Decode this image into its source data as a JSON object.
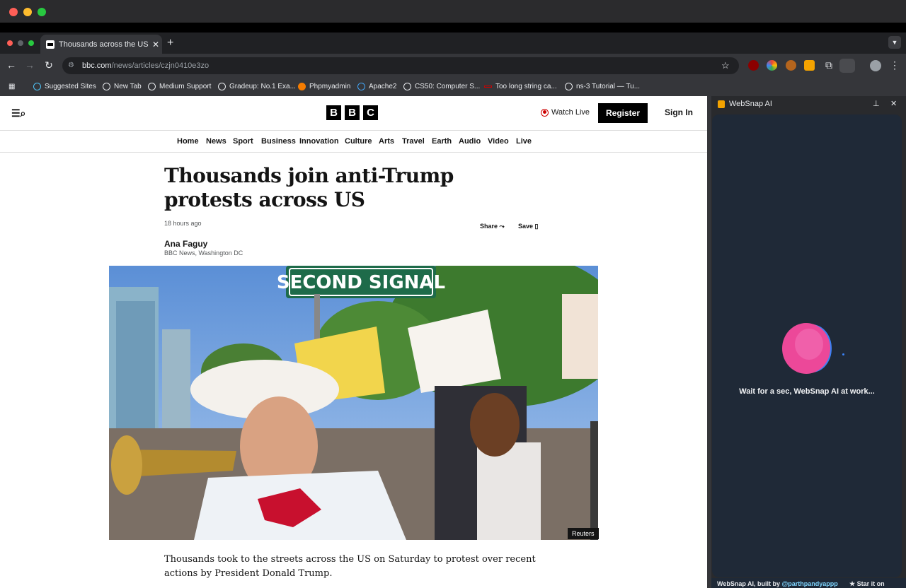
{
  "tab": {
    "title": "Thousands across the US pro",
    "close": "✕",
    "new": "+"
  },
  "omnibox": {
    "host": "bbc.com",
    "path": "/news/articles/czjn0410e3zo"
  },
  "bookmarks": [
    "Suggested Sites",
    "New Tab",
    "Medium Support",
    "Gradeup: No.1 Exa...",
    "Phpmyadmin",
    "Apache2",
    "CS50: Computer S...",
    "Too long string ca...",
    "ns-3 Tutorial — Tu..."
  ],
  "bbc": {
    "logo": [
      "B",
      "B",
      "C"
    ],
    "watch_live": "Watch Live",
    "register": "Register",
    "sign_in": "Sign In",
    "nav": [
      "Home",
      "News",
      "Sport",
      "Business",
      "Innovation",
      "Culture",
      "Arts",
      "Travel",
      "Earth",
      "Audio",
      "Video",
      "Live"
    ]
  },
  "article": {
    "headline": "Thousands join anti-Trump protests across US",
    "timestamp": "18 hours ago",
    "share": "Share",
    "save": "Save",
    "author": "Ana Faguy",
    "location": "BBC News, Washington DC",
    "image_credit": "Reuters",
    "sign_text": "SECOND SIGNAL",
    "lede": "Thousands took to the streets across the US on Saturday to protest over recent actions by President Donald Trump."
  },
  "panel": {
    "title": "WebSnap AI",
    "message": "Wait for a sec, WebSnap AI at work...",
    "footer_prefix": "WebSnap AI, built by ",
    "footer_handle": "@parthpandyappp",
    "footer_star": "★ Star it on"
  },
  "colors": {
    "brand_red": "#c00000",
    "chrome_dark": "#35363a",
    "panel_bg": "#1f2937"
  }
}
